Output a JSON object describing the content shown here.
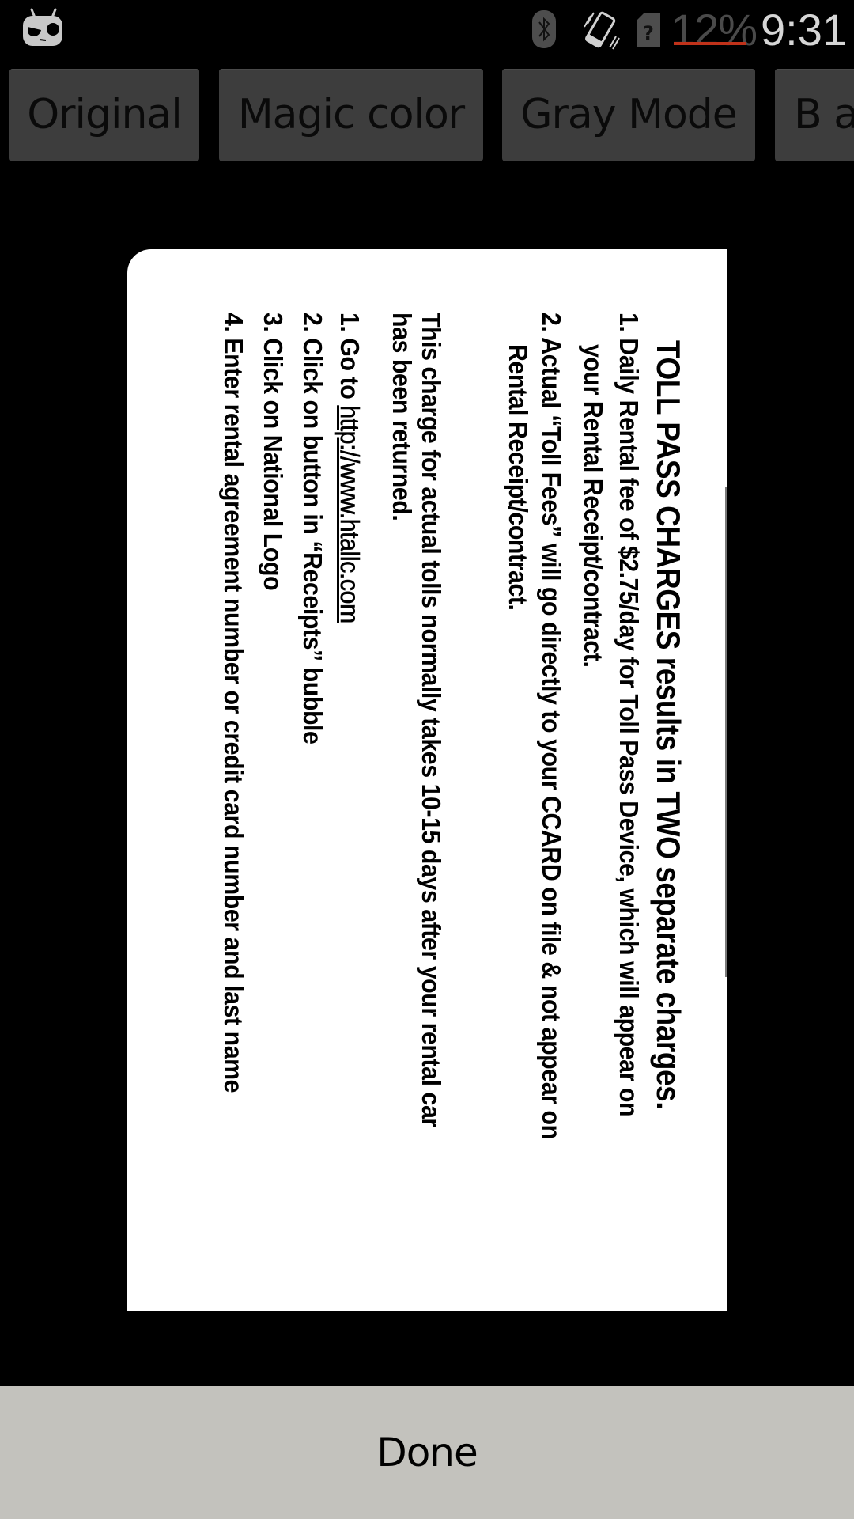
{
  "status_bar": {
    "launcher_icon": "cyanogenmod-icon",
    "icons": [
      "bluetooth-icon",
      "vibrate-icon",
      "no-sim-icon"
    ],
    "battery_percent": "12%",
    "battery_level": 0.12,
    "clock": "9:31",
    "colors": {
      "battery_low": "#c0321a",
      "clock": "#d6d6d6"
    }
  },
  "toolbar": {
    "filters": [
      {
        "label": "Original"
      },
      {
        "label": "Magic color"
      },
      {
        "label": "Gray Mode"
      },
      {
        "label": "B a"
      }
    ]
  },
  "document": {
    "orientation": "rotated 90° clockwise",
    "title": "TOLL PASS CHARGES results in TWO separate charges.",
    "charges": [
      {
        "line1": "1. Daily Rental fee of $2.75/day for Toll Pass Device, which will appear on",
        "line2": "your Rental Receipt/contract."
      },
      {
        "line1": "2. Actual “Toll Fees” will go directly to your CCARD on file & not appear on",
        "line2": "Rental Receipt/contract."
      }
    ],
    "note": {
      "line1": "This charge for actual tolls normally takes 10-15 days after your rental car",
      "line2": "has been returned."
    },
    "steps": [
      {
        "prefix": "1. Go to ",
        "link": "http://www.htallc.com"
      },
      {
        "text": "2. Click on button in “Receipts” bubble"
      },
      {
        "text": "3. Click on National Logo"
      },
      {
        "text": "4. Enter rental agreement number or credit card number and last name"
      }
    ]
  },
  "footer": {
    "done_label": "Done",
    "background": "#c3c2bd"
  }
}
